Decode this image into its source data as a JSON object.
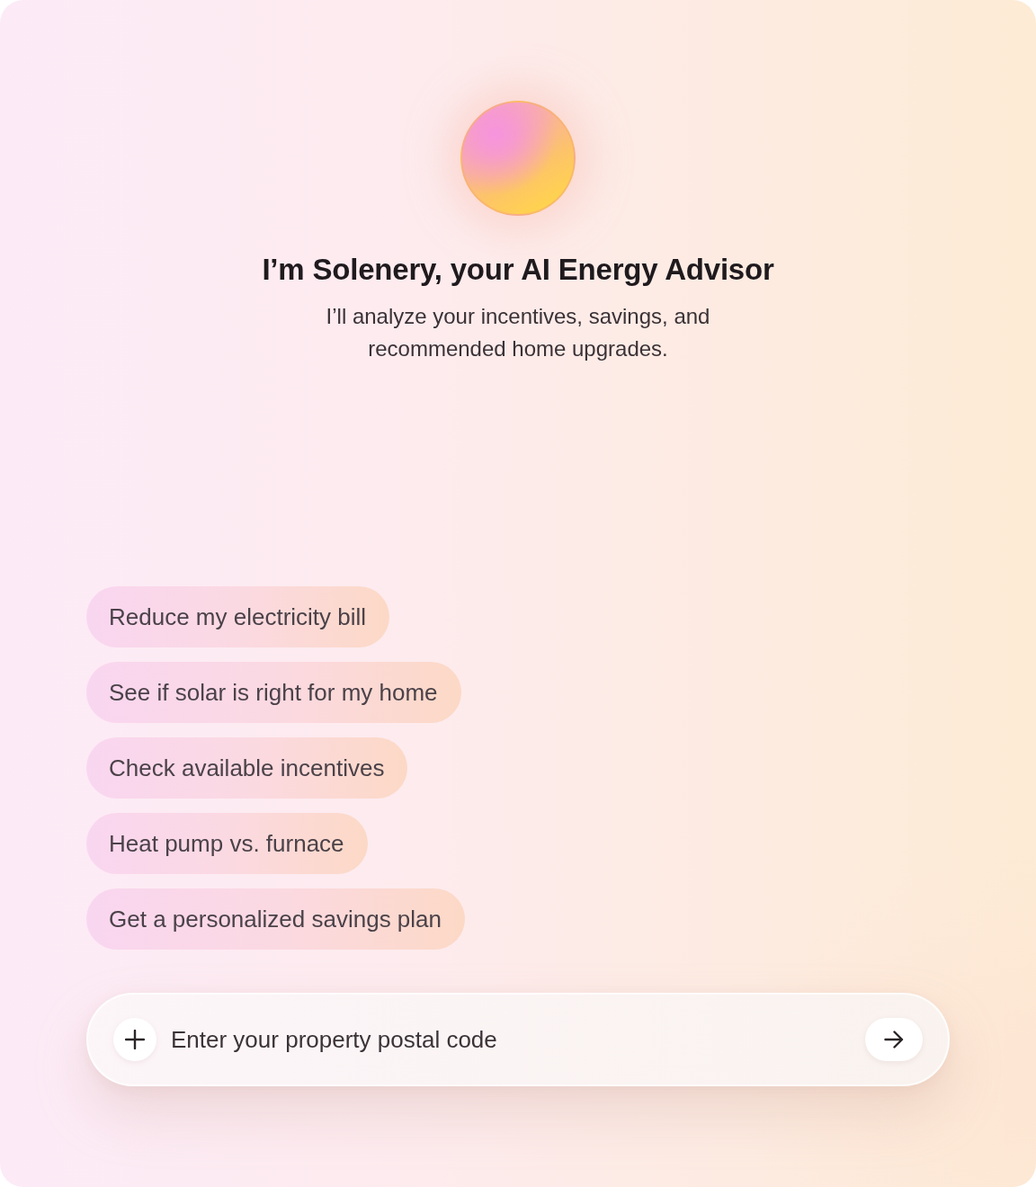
{
  "assistant": {
    "heading": "I’m Solenery, your AI Energy Advisor",
    "intro": "I’ll analyze your incentives, savings, and recommended home upgrades."
  },
  "suggestions": [
    {
      "label": "Reduce my electricity bill"
    },
    {
      "label": "See if solar is right for my home"
    },
    {
      "label": "Check available incentives"
    },
    {
      "label": "Heat pump vs. furnace"
    },
    {
      "label": "Get a personalized savings plan"
    }
  ],
  "composer": {
    "placeholder": "Enter your property postal code"
  }
}
